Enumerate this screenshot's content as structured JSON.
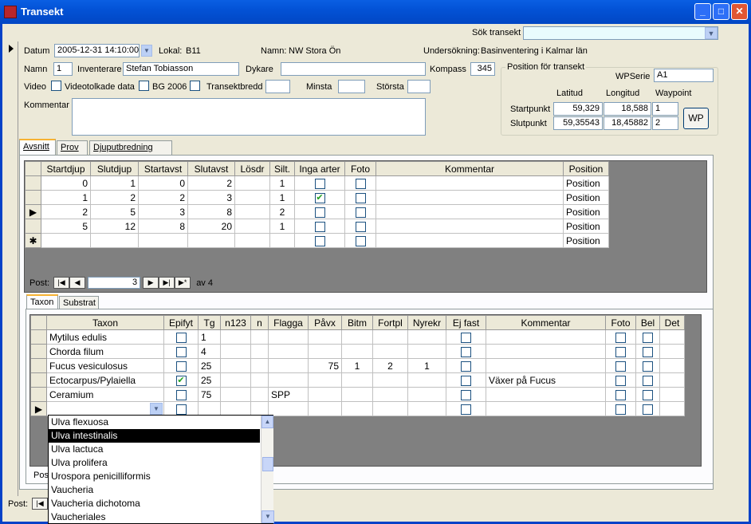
{
  "window": {
    "title": "Transekt",
    "min_label": "_",
    "max_label": "□",
    "close_label": "✕"
  },
  "search": {
    "label": "Sök transekt",
    "value": ""
  },
  "header": {
    "datum_label": "Datum",
    "datum_value": "2005-12-31 14:10:00",
    "lokal_label": "Lokal:",
    "lokal_value": "B11",
    "namn_label": "Namn:",
    "namn_value": "NW Stora Ön",
    "undersokning_label": "Undersökning:",
    "undersokning_value": "Basinventering i Kalmar län",
    "namn2_label": "Namn",
    "namn2_value": "1",
    "inventerare_label": "Inventerare",
    "inventerare_value": "Stefan Tobiasson",
    "dykare_label": "Dykare",
    "dykare_value": "",
    "kompass_label": "Kompass",
    "kompass_value": "345",
    "video_label": "Video",
    "videotolkade_label": "Videotolkade data",
    "bg_label": "BG 2006",
    "transektbredd_label": "Transektbredd",
    "transektbredd_value": "",
    "minsta_label": "Minsta",
    "minsta_value": "",
    "storsta_label": "Största",
    "storsta_value": "",
    "kommentar_label": "Kommentar",
    "kommentar_value": ""
  },
  "position": {
    "group_label": "Position för transekt",
    "wpserie_label": "WPSerie",
    "wpserie_value": "A1",
    "latitud_label": "Latitud",
    "longitud_label": "Longitud",
    "waypoint_label": "Waypoint",
    "start_label": "Startpunkt",
    "start_lat": "59,329",
    "start_lon": "18,588",
    "start_wp": "1",
    "slut_label": "Slutpunkt",
    "slut_lat": "59,35543",
    "slut_lon": "18,45882",
    "slut_wp": "2",
    "wp_button": "WP"
  },
  "tabs": [
    "Avsnitt",
    "Prov",
    "Djuputbredning"
  ],
  "avsnitt": {
    "columns": [
      "Startdjup",
      "Slutdjup",
      "Startavst",
      "Slutavst",
      "Lösdr",
      "Silt.",
      "Inga arter",
      "Foto",
      "Kommentar",
      "Position"
    ],
    "rows": [
      {
        "startdjup": "0",
        "slutdjup": "1",
        "startavst": "0",
        "slutavst": "2",
        "silt": "1",
        "inga": false,
        "pos": "Position"
      },
      {
        "startdjup": "1",
        "slutdjup": "2",
        "startavst": "2",
        "slutavst": "3",
        "silt": "1",
        "inga": true,
        "pos": "Position"
      },
      {
        "startdjup": "2",
        "slutdjup": "5",
        "startavst": "3",
        "slutavst": "8",
        "silt": "2",
        "inga": false,
        "pos": "Position"
      },
      {
        "startdjup": "5",
        "slutdjup": "12",
        "startavst": "8",
        "slutavst": "20",
        "silt": "1",
        "inga": false,
        "pos": "Position"
      },
      {
        "startdjup": "",
        "slutdjup": "",
        "startavst": "",
        "slutavst": "",
        "silt": "",
        "inga": false,
        "pos": "Position"
      }
    ],
    "nav_label": "Post:",
    "nav_value": "3",
    "nav_of": "av 4"
  },
  "subtabs": [
    "Taxon",
    "Substrat"
  ],
  "taxon": {
    "columns": [
      "Taxon",
      "Epifyt",
      "Tg",
      "n123",
      "n",
      "Flagga",
      "Påvx",
      "Bitm",
      "Fortpl",
      "Nyrekr",
      "Ej fast",
      "Kommentar",
      "Foto",
      "Bel",
      "Det"
    ],
    "rows": [
      {
        "taxon": "Mytilus edulis",
        "epifyt": false,
        "tg": "1",
        "flagga": "",
        "pavx": "",
        "bitm": "",
        "fortpl": "",
        "nyrekr": "",
        "kom": ""
      },
      {
        "taxon": "Chorda filum",
        "epifyt": false,
        "tg": "4",
        "flagga": "",
        "pavx": "",
        "bitm": "",
        "fortpl": "",
        "nyrekr": "",
        "kom": ""
      },
      {
        "taxon": "Fucus vesiculosus",
        "epifyt": false,
        "tg": "25",
        "flagga": "",
        "pavx": "75",
        "bitm": "1",
        "fortpl": "2",
        "nyrekr": "1",
        "kom": ""
      },
      {
        "taxon": "Ectocarpus/Pylaiella",
        "epifyt": true,
        "tg": "25",
        "flagga": "",
        "pavx": "",
        "bitm": "",
        "fortpl": "",
        "nyrekr": "",
        "kom": "Växer på Fucus"
      },
      {
        "taxon": "Ceramium",
        "epifyt": false,
        "tg": "75",
        "flagga": "SPP",
        "pavx": "",
        "bitm": "",
        "fortpl": "",
        "nyrekr": "",
        "kom": ""
      }
    ],
    "nav_label": "Post"
  },
  "dropdown": {
    "items": [
      "Ulva flexuosa",
      "Ulva intestinalis",
      "Ulva lactuca",
      "Ulva prolifera",
      "Urospora penicilliformis",
      "Vaucheria",
      "Vaucheria dichotoma",
      "Vaucheriales"
    ],
    "highlighted": 1
  },
  "footer": {
    "nav_label": "Post:"
  }
}
